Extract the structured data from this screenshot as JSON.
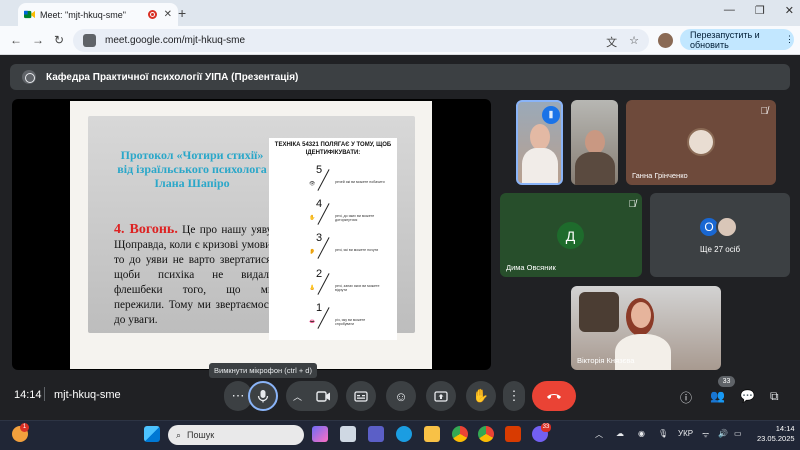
{
  "browser": {
    "tab_title": "Meet: \"mjt-hkuq-sme\"",
    "tab_close": "✕",
    "new_tab": "+",
    "window_controls": [
      "—",
      "❐",
      "✕"
    ],
    "nav": {
      "back": "←",
      "forward": "→",
      "reload": "↻"
    },
    "url": "meet.google.com/mjt-hkuq-sme",
    "update_button": "Перезапустить и обновить",
    "update_menu": "⋮"
  },
  "meeting": {
    "title": "Кафедра Практичної психології УІПА (Презентація)",
    "time": "14:14",
    "code": "mjt-hkuq-sme",
    "mic_tooltip": "Вимкнути мікрофон (ctrl + d)",
    "participants_count": "33"
  },
  "slide": {
    "title": "Протокол «Чотири стихії» від ізраїльського психолога Ілана Шапіро",
    "heading": "4. Вогонь.",
    "body": " Це про нашу уяву. Щоправда, коли є кризові умови, то до уяви не варто звертатися, щоби психіка не видала флешбеки того, що ми пережили. Тому ми звертаємося до уваги.",
    "technique_title": "ТЕХНІКА 54321 ПОЛЯГАЄ У ТОМУ, ЩОБ ІДЕНТИФІКУВАТИ:",
    "technique_items": [
      {
        "num": "5",
        "text": "речей які ви можете побачити",
        "icon": "👁"
      },
      {
        "num": "4",
        "text": "речі, до яких ви можете доторкнутися",
        "icon": "✋"
      },
      {
        "num": "3",
        "text": "речі, які ви можете почути",
        "icon": "👂"
      },
      {
        "num": "2",
        "text": "речі, запах яких ви можете відчути",
        "icon": "👃"
      },
      {
        "num": "1",
        "text": "річ, яку ви можете спробувати",
        "icon": "👄"
      }
    ]
  },
  "participants": {
    "tile3_name": "Ганна Грінченко",
    "tile4_name": "Дима Овсяник",
    "tile4_initial": "Д",
    "more_label": "Ще 27 осіб",
    "more_initial": "О",
    "tile6_name": "Вікторія Князєва"
  },
  "taskbar": {
    "search_placeholder": "Пошук",
    "language": "УКР",
    "time": "14:14",
    "date": "23.05.2025",
    "notification_count": "1",
    "badge_count": "33"
  }
}
